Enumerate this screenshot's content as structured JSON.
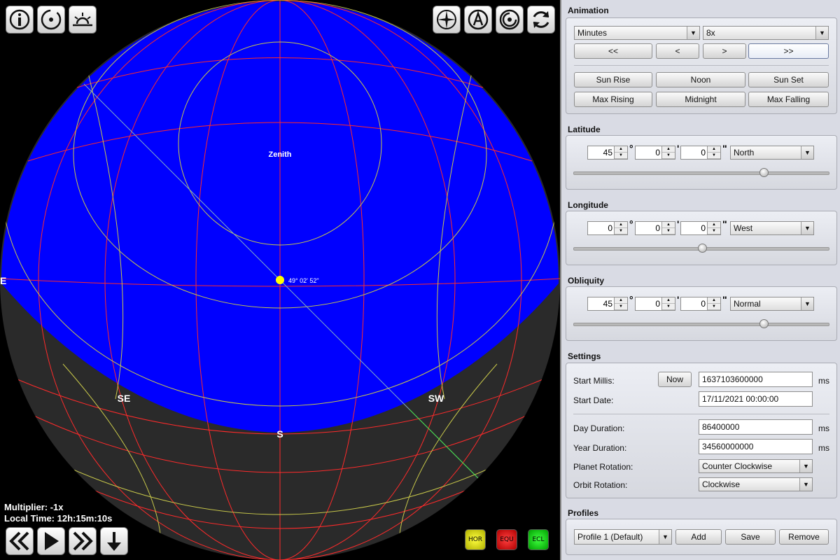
{
  "view": {
    "sky_labels": {
      "zenith": "Zenith",
      "sun_readout": "49° 02' 52\"",
      "east": "E",
      "southeast": "SE",
      "south": "S",
      "southwest": "SW"
    },
    "hud": {
      "multiplier": "Multiplier: -1x",
      "local_time": "Local Time: 12h:15m:10s"
    },
    "layer_buttons": {
      "horizon": "HOR",
      "equator": "EQU",
      "ecliptic": "ECL"
    },
    "colors": {
      "sky": "#0000ff",
      "ground": "#2a2a2a",
      "horizon_grid": "#ff2a2a",
      "equatorial_grid": "#c8c84a",
      "sun": "#ffff00",
      "ecliptic": "#44dd44"
    },
    "top_left_icons": [
      "info-icon",
      "orbit-icon",
      "sunrise-icon"
    ],
    "top_right_icons": [
      "compass-icon",
      "auto-icon",
      "orbit-rotate-icon",
      "refresh-icon"
    ]
  },
  "panel": {
    "animation": {
      "title": "Animation",
      "unit_select": "Minutes",
      "speed_select": "8x",
      "step_buttons": [
        "<<",
        "<",
        ">",
        ">>"
      ],
      "jump_buttons": [
        "Sun Rise",
        "Noon",
        "Sun Set",
        "Max Rising",
        "Midnight",
        "Max Falling"
      ]
    },
    "latitude": {
      "title": "Latitude",
      "deg": "45",
      "min": "0",
      "sec": "0",
      "dir": "North",
      "slider": 0.75
    },
    "longitude": {
      "title": "Longitude",
      "deg": "0",
      "min": "0",
      "sec": "0",
      "dir": "West",
      "slider": 0.5
    },
    "obliquity": {
      "title": "Obliquity",
      "deg": "45",
      "min": "0",
      "sec": "0",
      "dir": "Normal",
      "slider": 0.75
    },
    "settings": {
      "title": "Settings",
      "start_millis_label": "Start Millis:",
      "now_button": "Now",
      "start_millis": "1637103600000",
      "ms": "ms",
      "start_date_label": "Start Date:",
      "start_date": "17/11/2021 00:00:00",
      "day_duration_label": "Day Duration:",
      "day_duration": "86400000",
      "year_duration_label": "Year Duration:",
      "year_duration": "34560000000",
      "planet_rotation_label": "Planet Rotation:",
      "planet_rotation": "Counter Clockwise",
      "orbit_rotation_label": "Orbit Rotation:",
      "orbit_rotation": "Clockwise"
    },
    "profiles": {
      "title": "Profiles",
      "selected": "Profile 1 (Default)",
      "add": "Add",
      "save": "Save",
      "remove": "Remove"
    }
  }
}
